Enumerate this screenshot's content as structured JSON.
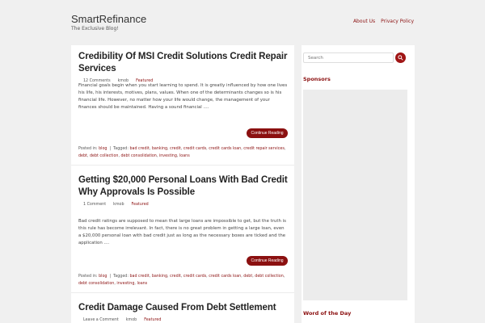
{
  "site": {
    "title": "SmartRefinance",
    "tagline": "The Exclusive Blog!"
  },
  "nav": {
    "items": [
      "About Us",
      "Privacy Policy"
    ]
  },
  "posts": [
    {
      "title": "Credibility Of MSI Credit Solutions Credit Repair Services",
      "comments": "12 Comments",
      "author": "kmob",
      "category": "Featured",
      "excerpt": "Financial goals begin when you start learning to spend. It is greatly influenced by how one lives his life, his interests, motives, plans, values. When one of the determinants changes so is his financial life. However, no matter how your life would change, the management of your finances should be maintained. Having a sound financial ....",
      "read_more": "Continue Reading",
      "posted_label": "Posted in:",
      "posted_in": "blog",
      "tagged_label": "Tagged:",
      "tags": [
        "bad credit",
        "banking",
        "credit",
        "credit cards",
        "credit cards loan",
        "credit repair services",
        "debt",
        "debt collection",
        "debt consolidation",
        "investing",
        "loans"
      ]
    },
    {
      "title": "Getting $20,000 Personal Loans With Bad Credit Why Approvals Is Possible",
      "comments": "1 Comment",
      "author": "kmob",
      "category": "Featured",
      "excerpt": "Bad credit ratings are supposed to mean that large loans are impossible to get, but the truth is this rule has become irrelevant. In fact, there is no great problem in getting a large loan, even a $20,000 personal loan with bad credit just as long as the necessary boxes are ticked and the application ....",
      "read_more": "Continue Reading",
      "posted_label": "Posted in:",
      "posted_in": "blog",
      "tagged_label": "Tagged:",
      "tags": [
        "bad credit",
        "banking",
        "credit",
        "credit cards",
        "credit cards loan",
        "debt",
        "debt collection",
        "debt consolidation",
        "investing",
        "loans"
      ]
    },
    {
      "title": "Credit Damage Caused From Debt Settlement",
      "comments": "Leave a Comment",
      "author": "kmob",
      "category": "Featured"
    }
  ],
  "sidebar": {
    "search_placeholder": "Search",
    "sponsors_title": "Sponsors",
    "word_of_day_title": "Word of the Day"
  },
  "colors": {
    "accent": "#8b1010",
    "background": "#f0f0f0"
  }
}
